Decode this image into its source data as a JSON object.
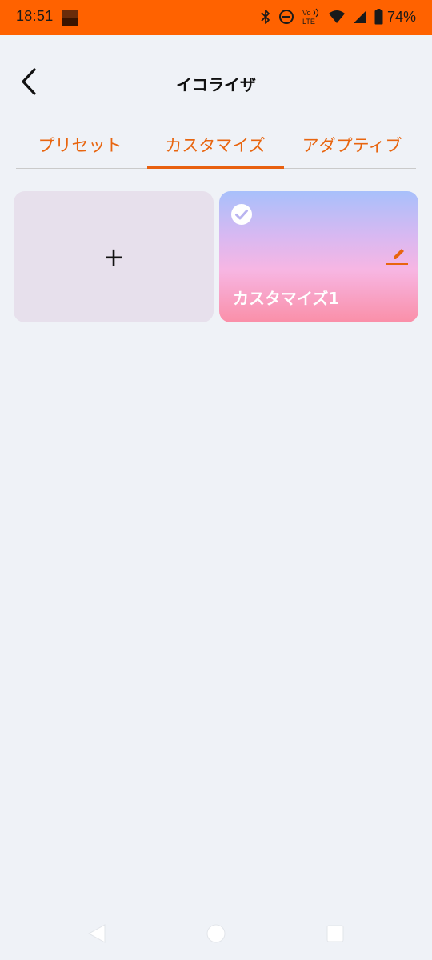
{
  "status_bar": {
    "time": "18:51",
    "battery": "74%",
    "icons": [
      "notification-icon",
      "bluetooth-icon",
      "do-not-disturb-icon",
      "volte-icon",
      "wifi-icon",
      "signal-icon",
      "battery-icon"
    ],
    "background_color": "#FF6200"
  },
  "header": {
    "title": "イコライザ",
    "back_icon": "back-arrow-icon"
  },
  "tabs": [
    {
      "label": "プリセット",
      "selected": false
    },
    {
      "label": "カスタマイズ",
      "selected": true
    },
    {
      "label": "アダプティブ",
      "selected": false
    }
  ],
  "cards": {
    "add": {
      "label": "+"
    },
    "custom": {
      "name": "カスタマイズ1",
      "selected": true,
      "check_icon": "check-circle-icon",
      "edit_icon": "edit-pencil-icon"
    }
  },
  "colors": {
    "accent": "#E8650F",
    "background": "#EFF2F7",
    "add_card": "#E7E0EC",
    "card_gradient_top": "#A8C0FB",
    "card_gradient_bottom": "#FA8FA8"
  },
  "nav": {
    "icons": [
      "back-triangle-icon",
      "home-circle-icon",
      "recents-square-icon"
    ]
  }
}
